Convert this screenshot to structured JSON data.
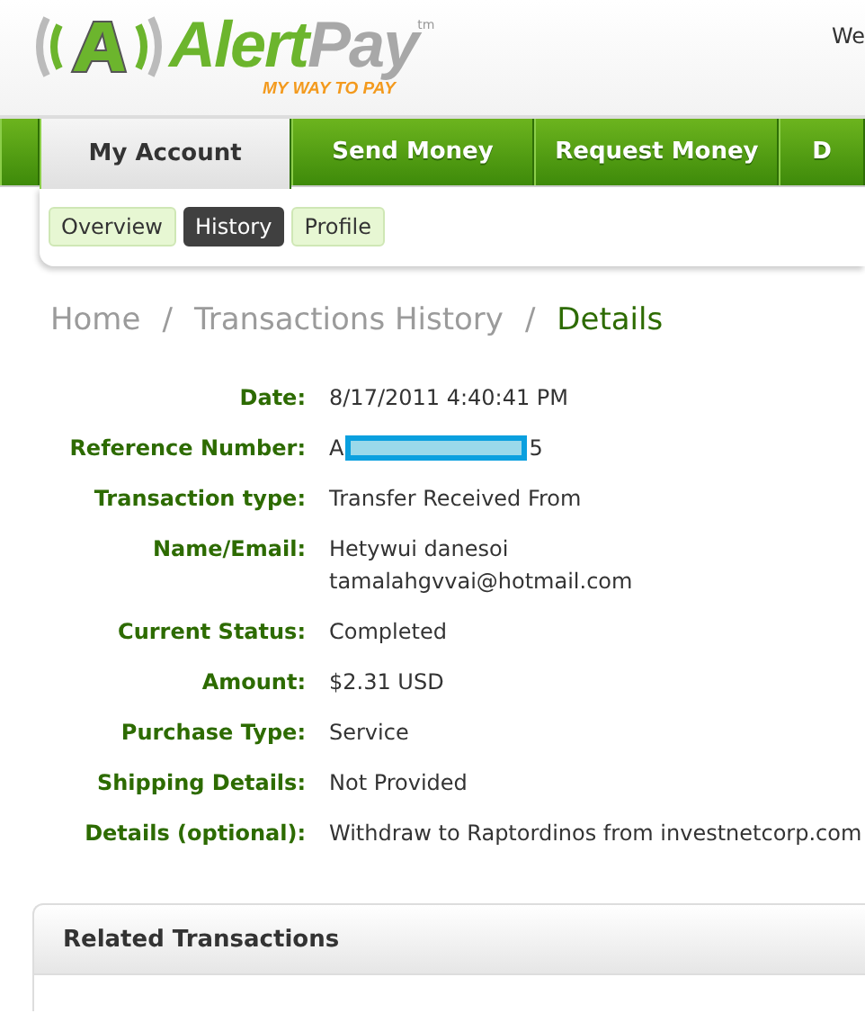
{
  "header": {
    "logo": {
      "name_start": "Alert",
      "name_end": "Pay",
      "trademark": "tm",
      "tagline": "MY WAY TO PAY"
    },
    "greeting": "We"
  },
  "main_tabs": [
    {
      "selected": false
    },
    {
      "label": "My Account",
      "selected": true
    },
    {
      "label": "Send Money",
      "selected": false
    },
    {
      "label": "Request Money",
      "selected": false
    },
    {
      "label": "D",
      "selected": false
    }
  ],
  "sub_tabs": [
    {
      "label": "Overview",
      "selected": false
    },
    {
      "label": "History",
      "selected": true
    },
    {
      "label": "Profile",
      "selected": false
    }
  ],
  "breadcrumb": [
    {
      "label": "Home",
      "selected": false
    },
    {
      "label": "Transactions History",
      "selected": false
    },
    {
      "label": "Details",
      "selected": true
    }
  ],
  "breadcrumb_separator": "/",
  "details": [
    {
      "kind": "text",
      "label": "Date:",
      "values": [
        "8/17/2011 4:40:41 PM"
      ]
    },
    {
      "kind": "redacted",
      "label": "Reference Number:",
      "values": [
        "A",
        "5"
      ]
    },
    {
      "kind": "text",
      "label": "Transaction type:",
      "values": [
        "Transfer Received From"
      ]
    },
    {
      "kind": "text",
      "label": "Name/Email:",
      "values": [
        "Hetywui danesoi",
        "tamalahgvvai@hotmail.com"
      ]
    },
    {
      "kind": "text",
      "label": "Current Status:",
      "values": [
        "Completed"
      ]
    },
    {
      "kind": "text",
      "label": "Amount:",
      "values": [
        "$2.31 USD"
      ]
    },
    {
      "kind": "text",
      "label": "Purchase Type:",
      "values": [
        "Service"
      ]
    },
    {
      "kind": "text",
      "label": "Shipping Details:",
      "values": [
        "Not Provided"
      ]
    },
    {
      "kind": "text",
      "label": "Details (optional):",
      "values": [
        "Withdraw to Raptordinos from investnetcorp.com"
      ]
    }
  ],
  "related_panel": {
    "title": "Related Transactions"
  }
}
